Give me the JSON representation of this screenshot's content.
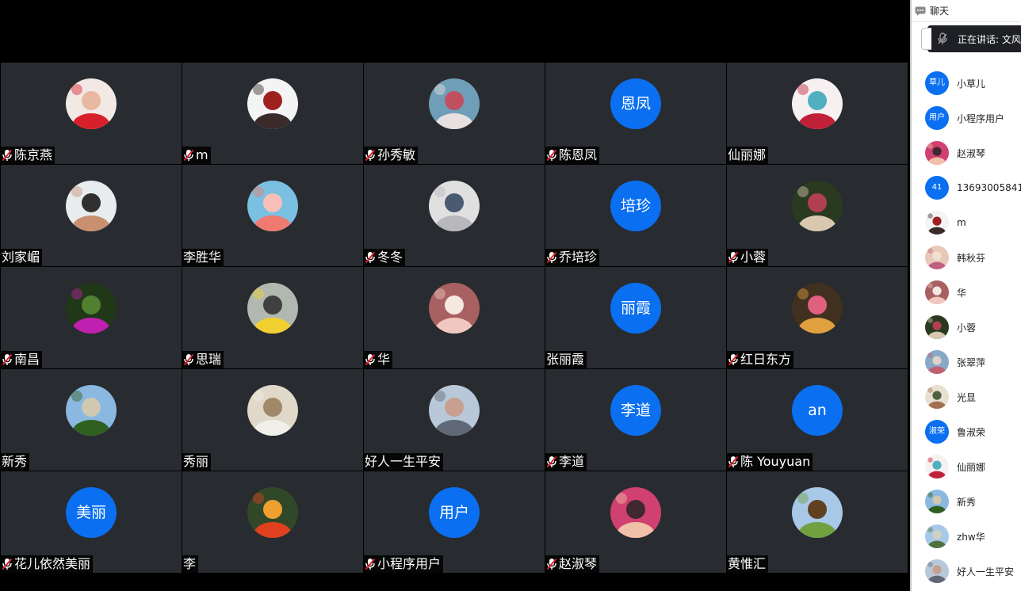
{
  "tiles": [
    {
      "name": "陈京燕",
      "muted": true,
      "avatar_type": "photo",
      "photo": {
        "bg": "#f2e8e4",
        "fg": "#d8202a",
        "accent": "#e8b8a0"
      }
    },
    {
      "name": "m",
      "muted": true,
      "avatar_type": "photo",
      "photo": {
        "bg": "#f4f4f4",
        "fg": "#3a2a2a",
        "accent": "#a02020"
      }
    },
    {
      "name": "孙秀敏",
      "muted": true,
      "avatar_type": "photo",
      "photo": {
        "bg": "#6f9fb8",
        "fg": "#e8e0e0",
        "accent": "#c05060"
      }
    },
    {
      "name": "陈恩凤",
      "muted": true,
      "avatar_type": "text",
      "avatar_text": "恩凤"
    },
    {
      "name": "仙丽娜",
      "muted": false,
      "avatar_type": "photo",
      "photo": {
        "bg": "#f6f0f0",
        "fg": "#c02038",
        "accent": "#50b0c0"
      }
    },
    {
      "name": "刘家嵋",
      "muted": false,
      "avatar_type": "photo",
      "photo": {
        "bg": "#e8ecee",
        "fg": "#c89070",
        "accent": "#303030"
      }
    },
    {
      "name": "李胜华",
      "muted": false,
      "avatar_type": "photo",
      "photo": {
        "bg": "#7ac0e0",
        "fg": "#f07a70",
        "accent": "#f8c0b8"
      }
    },
    {
      "name": "冬冬",
      "muted": true,
      "avatar_type": "photo",
      "photo": {
        "bg": "#e0e0e0",
        "fg": "#b8b8bc",
        "accent": "#4a5a70"
      }
    },
    {
      "name": "乔培珍",
      "muted": true,
      "avatar_type": "text",
      "avatar_text": "培珍"
    },
    {
      "name": "小蓉",
      "muted": true,
      "avatar_type": "photo",
      "photo": {
        "bg": "#2a3a20",
        "fg": "#d8c8b0",
        "accent": "#b04050"
      }
    },
    {
      "name": "南昌",
      "muted": true,
      "avatar_type": "photo",
      "photo": {
        "bg": "#203818",
        "fg": "#c020b0",
        "accent": "#508030"
      }
    },
    {
      "name": "思瑞",
      "muted": true,
      "avatar_type": "photo",
      "photo": {
        "bg": "#b0b8b0",
        "fg": "#f0d030",
        "accent": "#404040"
      }
    },
    {
      "name": "华",
      "muted": true,
      "avatar_type": "photo",
      "photo": {
        "bg": "#a86060",
        "fg": "#f0c8c0",
        "accent": "#f4e8e0"
      }
    },
    {
      "name": "张丽霞",
      "muted": false,
      "avatar_type": "text",
      "avatar_text": "丽霞"
    },
    {
      "name": "红日东方",
      "muted": true,
      "avatar_type": "photo",
      "photo": {
        "bg": "#403020",
        "fg": "#e0a040",
        "accent": "#e06080"
      }
    },
    {
      "name": "新秀",
      "muted": false,
      "avatar_type": "photo",
      "photo": {
        "bg": "#8ab8e0",
        "fg": "#306020",
        "accent": "#d0c8b0"
      }
    },
    {
      "name": "秀丽",
      "muted": false,
      "avatar_type": "photo",
      "photo": {
        "bg": "#e0d8c8",
        "fg": "#f0f0e8",
        "accent": "#a08868"
      }
    },
    {
      "name": "好人一生平安",
      "muted": false,
      "avatar_type": "photo",
      "photo": {
        "bg": "#b8c8d8",
        "fg": "#606878",
        "accent": "#c8a090"
      }
    },
    {
      "name": "李道",
      "muted": true,
      "avatar_type": "text",
      "avatar_text": "李道"
    },
    {
      "name": "陈 Youyuan",
      "muted": true,
      "avatar_type": "text",
      "avatar_text": "an"
    },
    {
      "name": "花儿依然美丽",
      "muted": true,
      "avatar_type": "text",
      "avatar_text": "美丽"
    },
    {
      "name": "李",
      "muted": false,
      "avatar_type": "photo",
      "photo": {
        "bg": "#304828",
        "fg": "#e04020",
        "accent": "#f0a030"
      }
    },
    {
      "name": "小程序用户",
      "muted": true,
      "avatar_type": "text",
      "avatar_text": "用户"
    },
    {
      "name": "赵淑琴",
      "muted": true,
      "avatar_type": "photo",
      "photo": {
        "bg": "#d04070",
        "fg": "#f0c0a8",
        "accent": "#402830"
      }
    },
    {
      "name": "黄惟汇",
      "muted": false,
      "avatar_type": "photo",
      "photo": {
        "bg": "#a8c8e8",
        "fg": "#70a040",
        "accent": "#604020"
      }
    }
  ],
  "panel": {
    "title": "聊天",
    "speaking_text": "正在讲话: 文风"
  },
  "participants": [
    {
      "name": "小草儿",
      "avatar_type": "text",
      "avatar_text": "草儿"
    },
    {
      "name": "小程序用户",
      "avatar_type": "text",
      "avatar_text": "用户"
    },
    {
      "name": "赵淑琴",
      "avatar_type": "photo",
      "photo": {
        "bg": "#d04070",
        "fg": "#f0c0a8",
        "accent": "#402830"
      }
    },
    {
      "name": "13693005841",
      "avatar_type": "text",
      "avatar_text": "41"
    },
    {
      "name": "m",
      "avatar_type": "photo",
      "photo": {
        "bg": "#f4f4f4",
        "fg": "#3a2a2a",
        "accent": "#a02020"
      }
    },
    {
      "name": "韩秋芬",
      "avatar_type": "photo",
      "photo": {
        "bg": "#e8c8b8",
        "fg": "#c06080",
        "accent": "#f0e0d0"
      }
    },
    {
      "name": "华",
      "avatar_type": "photo",
      "photo": {
        "bg": "#a86060",
        "fg": "#f0c8c0",
        "accent": "#f4e8e0"
      }
    },
    {
      "name": "小蓉",
      "avatar_type": "photo",
      "photo": {
        "bg": "#2a3a20",
        "fg": "#d8c8b0",
        "accent": "#b04050"
      }
    },
    {
      "name": "张翠萍",
      "avatar_type": "photo",
      "photo": {
        "bg": "#88a8c8",
        "fg": "#c06070",
        "accent": "#e0d0c8"
      }
    },
    {
      "name": "光显",
      "avatar_type": "photo",
      "photo": {
        "bg": "#e8e0d0",
        "fg": "#a07050",
        "accent": "#506040"
      }
    },
    {
      "name": "鲁淑荣",
      "avatar_type": "text",
      "avatar_text": "淑荣"
    },
    {
      "name": "仙丽娜",
      "avatar_type": "photo",
      "photo": {
        "bg": "#f6f0f0",
        "fg": "#c02038",
        "accent": "#50b0c0"
      }
    },
    {
      "name": "新秀",
      "avatar_type": "photo",
      "photo": {
        "bg": "#8ab8e0",
        "fg": "#306020",
        "accent": "#d0c8b0"
      }
    },
    {
      "name": "zhw华",
      "avatar_type": "photo",
      "photo": {
        "bg": "#a8c8e8",
        "fg": "#507040",
        "accent": "#d0d0c0"
      }
    },
    {
      "name": "好人一生平安",
      "avatar_type": "photo",
      "photo": {
        "bg": "#b8c8d8",
        "fg": "#606878",
        "accent": "#c8a090"
      }
    }
  ],
  "colors": {
    "tile_bg": "#282b30",
    "avatar_blue": "#0a6ff0",
    "mic_red": "#e0202a"
  }
}
